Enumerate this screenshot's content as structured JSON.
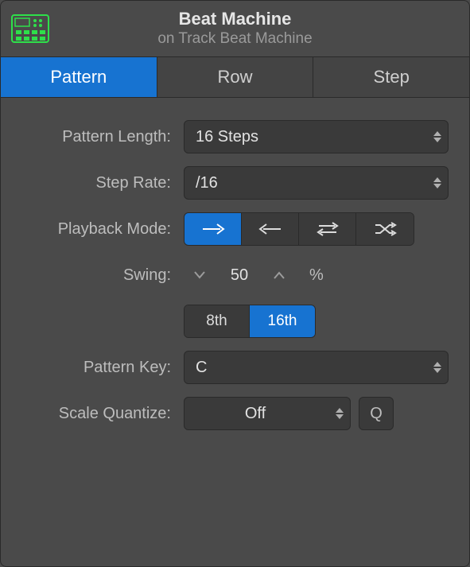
{
  "header": {
    "title": "Beat Machine",
    "subtitle": "on Track Beat Machine"
  },
  "tabs": {
    "items": [
      {
        "label": "Pattern",
        "active": true
      },
      {
        "label": "Row",
        "active": false
      },
      {
        "label": "Step",
        "active": false
      }
    ]
  },
  "fields": {
    "pattern_length": {
      "label": "Pattern Length:",
      "value": "16 Steps"
    },
    "step_rate": {
      "label": "Step Rate:",
      "value": "/16"
    },
    "playback_mode": {
      "label": "Playback Mode:",
      "options": [
        "forward",
        "backward",
        "pingpong",
        "random"
      ],
      "selected": 0
    },
    "swing": {
      "label": "Swing:",
      "value": "50",
      "unit": "%",
      "division": {
        "options": [
          "8th",
          "16th"
        ],
        "selected": 1
      }
    },
    "pattern_key": {
      "label": "Pattern Key:",
      "value": "C"
    },
    "scale_quantize": {
      "label": "Scale Quantize:",
      "value": "Off",
      "q_label": "Q"
    }
  }
}
